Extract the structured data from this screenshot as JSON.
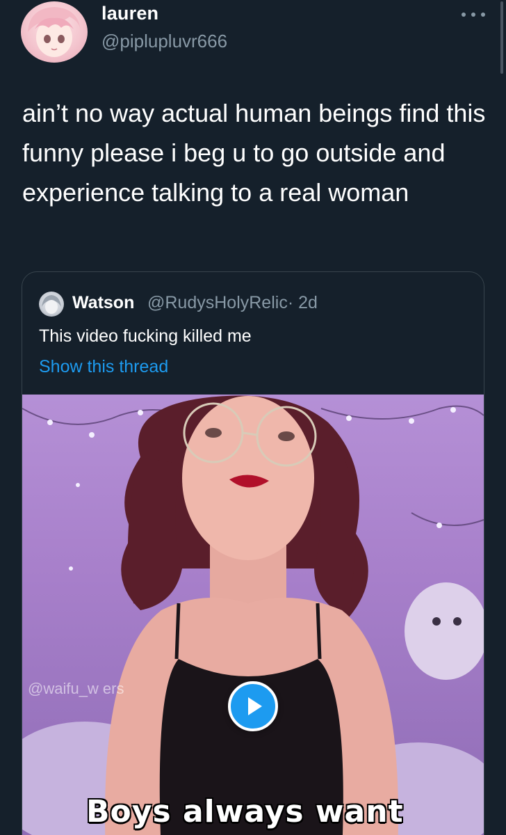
{
  "tweet": {
    "author": {
      "display_name": "lauren",
      "handle": "@piplupluvr666"
    },
    "more_icon": "more-horizontal-icon",
    "text": "ain’t no way actual human beings find this funny please i beg u to go outside and experience talking to a real woman"
  },
  "quoted_tweet": {
    "author": {
      "display_name": "Watson",
      "handle": "@RudysHolyRelic",
      "time": "· 2d"
    },
    "text": "This video fucking killed me",
    "show_thread_label": "Show this thread",
    "media": {
      "type": "video",
      "watermark": "@waifu_w   ers",
      "caption": "Boys always want",
      "play_icon": "play-icon"
    }
  },
  "colors": {
    "background": "#15202b",
    "secondary_text": "#8899a6",
    "link": "#1d9bf0",
    "border": "#38444d"
  }
}
